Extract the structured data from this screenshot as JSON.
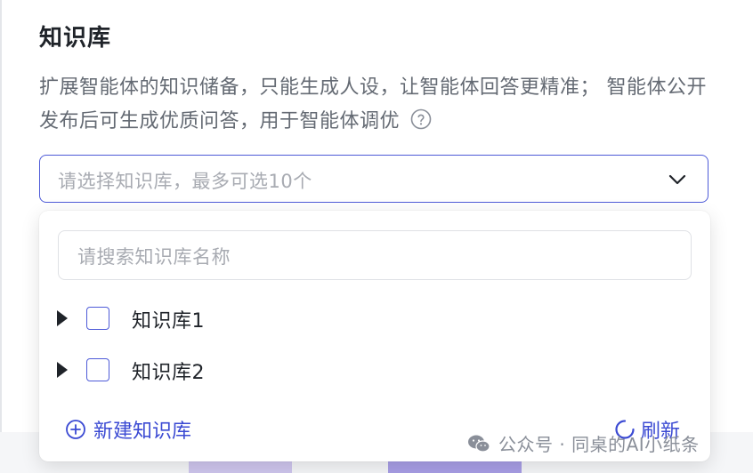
{
  "section": {
    "title": "知识库",
    "description": "扩展智能体的知识储备，只能生成人设，让智能体回答更精准； 智能体公开发布后可生成优质问答，用于智能体调优"
  },
  "select": {
    "placeholder": "请选择知识库，最多可选10个"
  },
  "dropdown": {
    "search_placeholder": "请搜索知识库名称",
    "items": [
      {
        "label": "知识库1",
        "checked": false
      },
      {
        "label": "知识库2",
        "checked": false
      }
    ],
    "create_label": "新建知识库",
    "refresh_label": "刷新"
  },
  "watermark": {
    "text": "公众号 · 同桌的AI小纸条"
  },
  "colors": {
    "accent": "#3b4ad3",
    "border_active": "#4e5bd8",
    "text_primary": "#1f2329",
    "text_secondary": "#646a73",
    "placeholder": "#a8abb2"
  },
  "icons": {
    "help": "help-circle-icon",
    "chevron": "chevron-down-icon",
    "caret": "caret-right-icon",
    "create": "plus-circle-icon",
    "refresh": "refresh-icon",
    "wechat": "wechat-icon"
  }
}
